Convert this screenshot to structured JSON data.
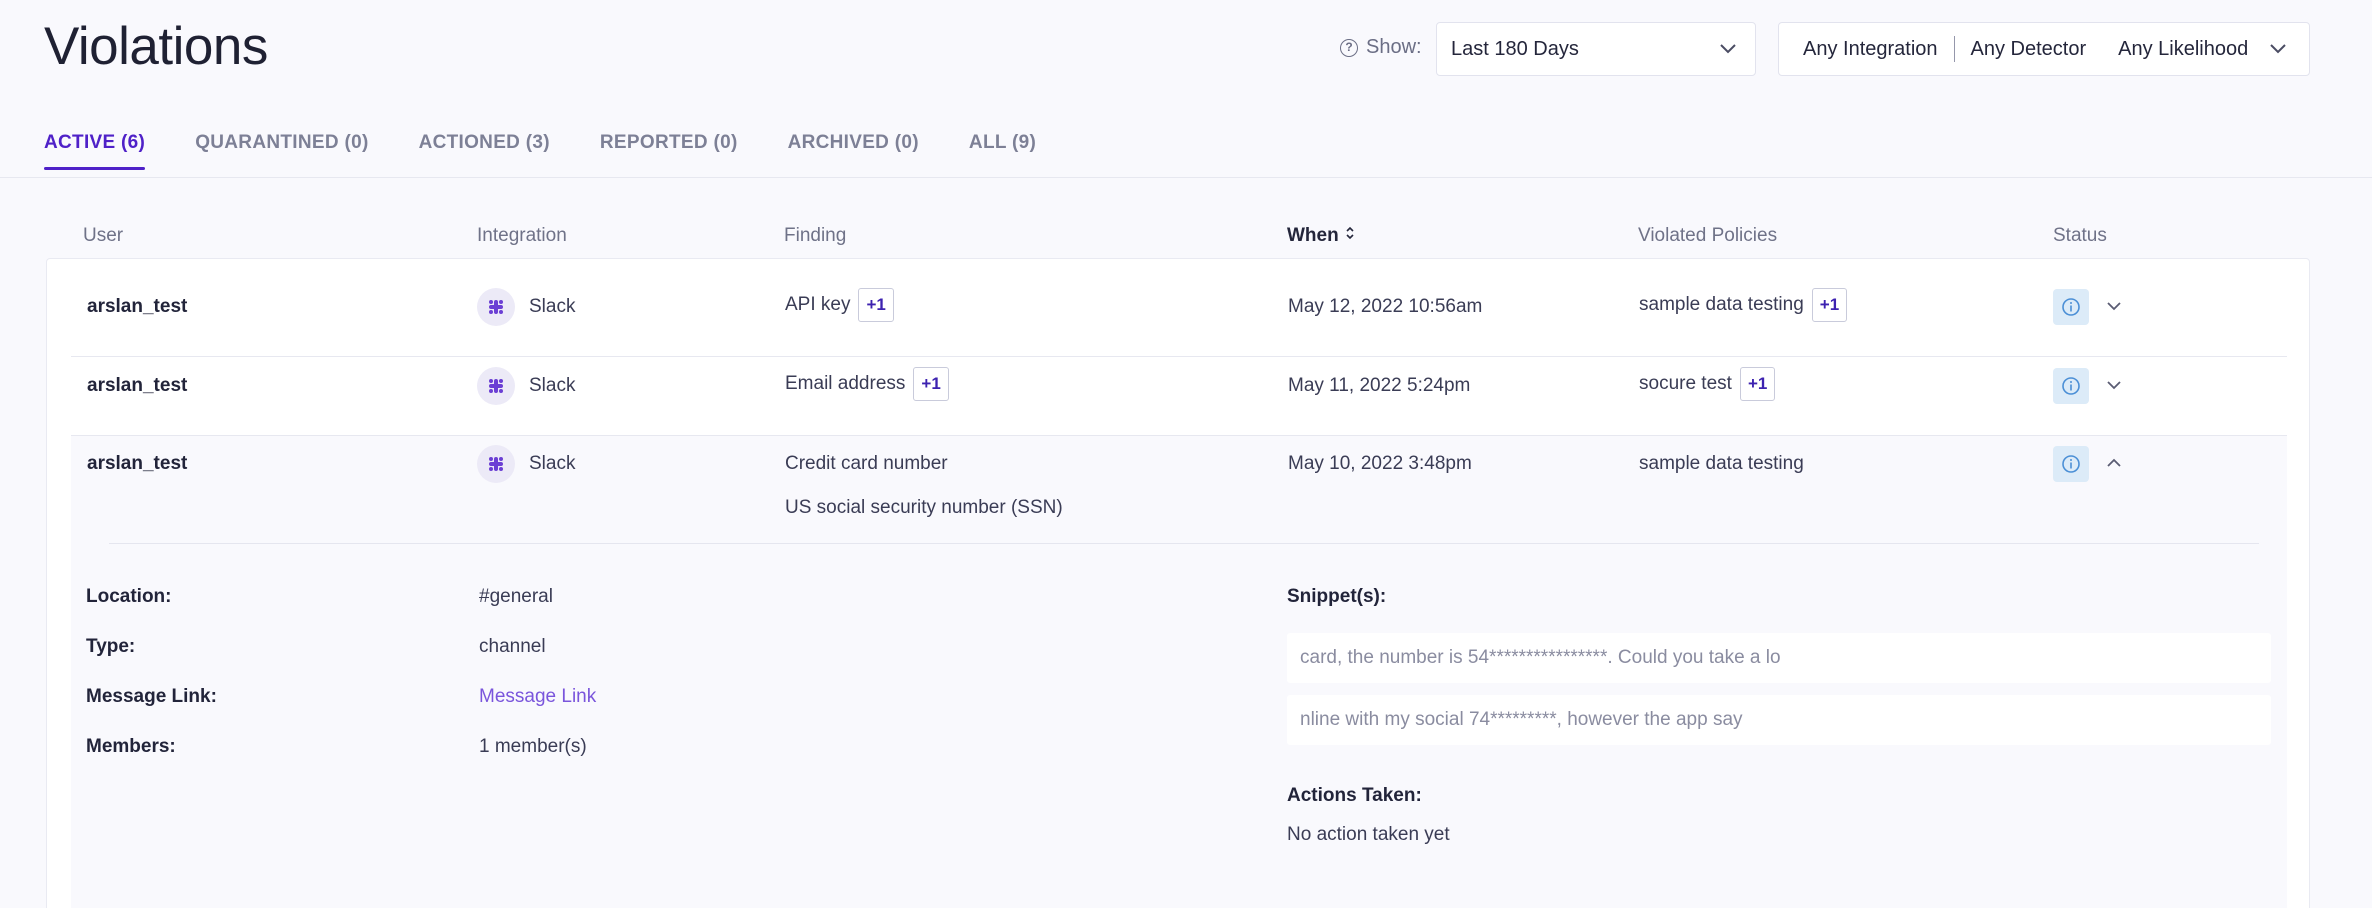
{
  "header": {
    "title": "Violations",
    "show_label": "Show:",
    "range": "Last 180 Days",
    "filters": [
      "Any Integration",
      "Any Detector",
      "Any Likelihood"
    ]
  },
  "tabs": [
    {
      "label": "ACTIVE (6)"
    },
    {
      "label": "QUARANTINED (0)"
    },
    {
      "label": "ACTIONED (3)"
    },
    {
      "label": "REPORTED (0)"
    },
    {
      "label": "ARCHIVED (0)"
    },
    {
      "label": "ALL (9)"
    }
  ],
  "columns": {
    "user": "User",
    "integration": "Integration",
    "finding": "Finding",
    "when": "When",
    "policies": "Violated Policies",
    "status": "Status"
  },
  "rows": [
    {
      "user": "arslan_test",
      "integration": "Slack",
      "finding": "API key",
      "finding_extra": "+1",
      "when": "May 12, 2022 10:56am",
      "policy": "sample data testing",
      "policy_extra": "+1"
    },
    {
      "user": "arslan_test",
      "integration": "Slack",
      "finding": "Email address",
      "finding_extra": "+1",
      "when": "May 11, 2022 5:24pm",
      "policy": "socure test",
      "policy_extra": "+1"
    },
    {
      "user": "arslan_test",
      "integration": "Slack",
      "finding": "Credit card number",
      "finding_2": "US social security number (SSN)",
      "when": "May 10, 2022 3:48pm",
      "policy": "sample data testing"
    }
  ],
  "details": {
    "location_label": "Location:",
    "location": "#general",
    "type_label": "Type:",
    "type": "channel",
    "link_label": "Message Link:",
    "link": "Message Link",
    "members_label": "Members:",
    "members": "1 member(s)",
    "snippets_label": "Snippet(s):",
    "snippets": [
      "card, the number is 54****************. Could you take a lo",
      "nline with my social 74*********, however the app say"
    ],
    "actions_label": "Actions Taken:",
    "actions": "No action taken yet"
  },
  "colors": {
    "accent": "#4f21c8",
    "link": "#7a55dc",
    "status_bg": "#dcebf8"
  }
}
